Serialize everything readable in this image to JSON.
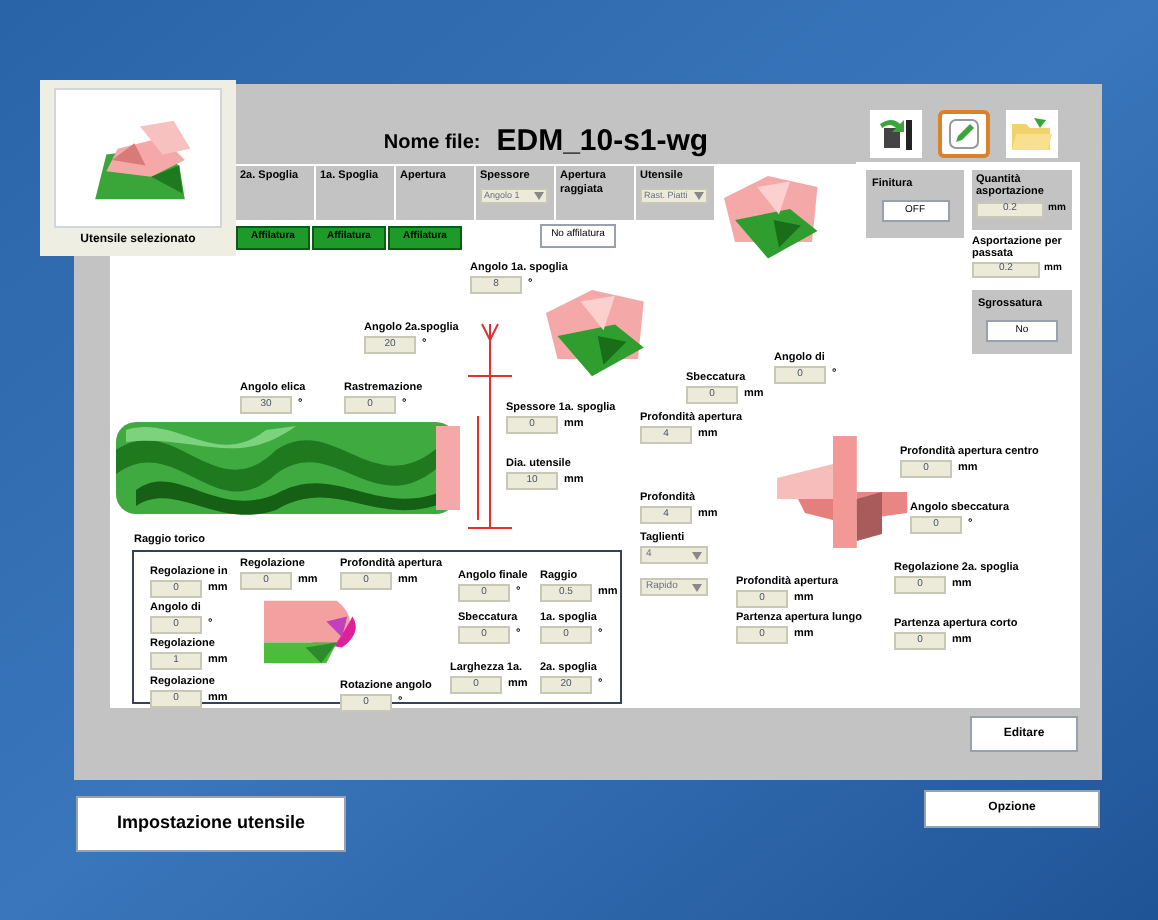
{
  "thumbnail": {
    "caption": "Utensile selezionato"
  },
  "header": {
    "label": "Nome file:",
    "filename": "EDM_10-s1-wg"
  },
  "toolbar": [
    {
      "kind": "transfer",
      "selected": false
    },
    {
      "kind": "edit",
      "selected": true
    },
    {
      "kind": "folder",
      "selected": false
    }
  ],
  "columns": [
    {
      "label": "2a. Spoglia",
      "kind": "plain"
    },
    {
      "label": "1a. Spoglia",
      "kind": "plain"
    },
    {
      "label": "Apertura",
      "kind": "plain"
    },
    {
      "label": "Spessore",
      "kind": "select",
      "value": "Angolo 1"
    },
    {
      "label": "Apertura raggiata",
      "kind": "plain"
    },
    {
      "label": "Utensile",
      "kind": "select",
      "value": "Rast. Piatti"
    }
  ],
  "affilatura_buttons": [
    "Affilatura",
    "Affilatura",
    "Affilatura"
  ],
  "raggiata_value": "No affilatura",
  "finitura": {
    "label": "Finitura",
    "value": "OFF"
  },
  "quantita": {
    "label": "Quantità asportazione",
    "value": "0.2",
    "unit": "mm"
  },
  "passata": {
    "label": "Asportazione per passata",
    "value": "0.2",
    "unit": "mm"
  },
  "sgrossatura": {
    "label": "Sgrossatura",
    "value": "No"
  },
  "fields": [
    {
      "kind": "input",
      "label": "Angolo 1a. spoglia",
      "value": "8",
      "unit": "°"
    },
    {
      "kind": "input",
      "label": "Angolo 2a.spoglia",
      "value": "20",
      "unit": "°"
    },
    {
      "kind": "input",
      "label": "Angolo elica",
      "value": "30",
      "unit": "°"
    },
    {
      "kind": "input",
      "label": "Rastremazione",
      "value": "0",
      "unit": "°"
    },
    {
      "kind": "input",
      "label": "Spessore 1a. spoglia",
      "value": "0",
      "unit": "mm"
    },
    {
      "kind": "input",
      "label": "Dia. utensile",
      "value": "10",
      "unit": "mm"
    },
    {
      "kind": "input",
      "label": "Sbeccatura",
      "value": "0",
      "unit": "mm"
    },
    {
      "kind": "input",
      "label": "Angolo di",
      "value": "0",
      "unit": "°"
    },
    {
      "kind": "input",
      "label": "Profondità apertura",
      "value": "4",
      "unit": "mm"
    },
    {
      "kind": "input",
      "label": "Profondità",
      "value": "4",
      "unit": "mm"
    },
    {
      "kind": "select",
      "label": "Taglienti",
      "value": "4"
    },
    {
      "kind": "select",
      "value": "Rapido"
    },
    {
      "kind": "input",
      "label": "Profondità apertura centro",
      "value": "0",
      "unit": "mm"
    },
    {
      "kind": "input",
      "label": "Angolo sbeccatura",
      "value": "0",
      "unit": "°"
    },
    {
      "kind": "input",
      "label": "Regolazione 2a. spoglia",
      "value": "0",
      "unit": "mm"
    },
    {
      "kind": "input",
      "label": "Profondità apertura",
      "value": "0",
      "unit": "mm"
    },
    {
      "kind": "input",
      "label": "Partenza apertura lungo",
      "value": "0",
      "unit": "mm"
    },
    {
      "kind": "input",
      "label": "Partenza apertura corto",
      "value": "0",
      "unit": "mm"
    }
  ],
  "raggio_torico": {
    "title": "Raggio torico",
    "fields": [
      {
        "kind": "input",
        "label": "Regolazione in",
        "value": "0",
        "unit": "mm"
      },
      {
        "kind": "input",
        "label": "Angolo di",
        "value": "0",
        "unit": "°"
      },
      {
        "kind": "input",
        "label": "Regolazione",
        "value": "1",
        "unit": "mm"
      },
      {
        "kind": "input",
        "label": "Regolazione",
        "value": "0",
        "unit": "mm"
      },
      {
        "kind": "input",
        "label": "Regolazione",
        "value": "0",
        "unit": "mm"
      },
      {
        "kind": "input",
        "label": "Profondità apertura",
        "value": "0",
        "unit": "mm"
      },
      {
        "kind": "input",
        "label": "Rotazione angolo",
        "value": "0",
        "unit": "°"
      },
      {
        "kind": "input",
        "label": "Angolo finale",
        "value": "0",
        "unit": "°"
      },
      {
        "kind": "input",
        "label": "Raggio",
        "value": "0.5",
        "unit": "mm"
      },
      {
        "kind": "input",
        "label": "Sbeccatura",
        "value": "0",
        "unit": "°"
      },
      {
        "kind": "input",
        "label": "1a. spoglia",
        "value": "0",
        "unit": "°"
      },
      {
        "kind": "input",
        "label": "Larghezza 1a.",
        "value": "0",
        "unit": "mm"
      },
      {
        "kind": "input",
        "label": "2a. spoglia",
        "value": "20",
        "unit": "°"
      }
    ]
  },
  "editare_button": "Editare",
  "impostazione_button": "Impostazione utensile",
  "opzione_button": "Opzione"
}
